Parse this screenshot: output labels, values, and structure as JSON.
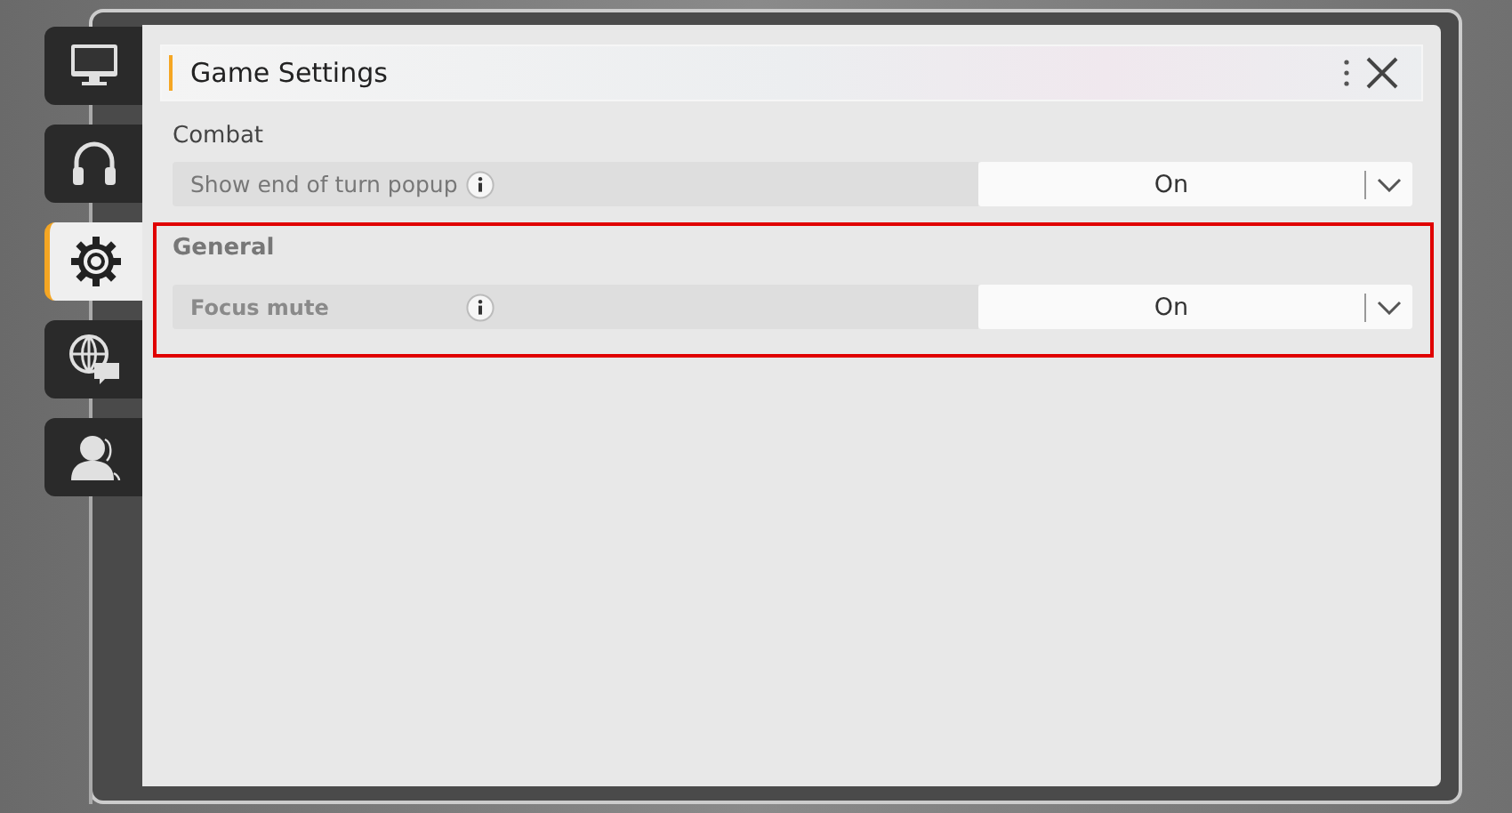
{
  "sidebar": {
    "tabs": [
      {
        "kind": "monitor",
        "selected": false
      },
      {
        "kind": "headphones",
        "selected": false
      },
      {
        "kind": "gear",
        "selected": true
      },
      {
        "kind": "globe-chat",
        "selected": false
      },
      {
        "kind": "person",
        "selected": false
      }
    ]
  },
  "panel": {
    "title": "Game Settings"
  },
  "sections": [
    {
      "title": "Combat",
      "highlighted": false,
      "settings": [
        {
          "label": "Show end of turn popup",
          "value": "On",
          "disabled": false
        }
      ]
    },
    {
      "title": "General",
      "highlighted": true,
      "settings": [
        {
          "label": "Focus mute",
          "value": "On",
          "disabled": true
        }
      ]
    }
  ]
}
